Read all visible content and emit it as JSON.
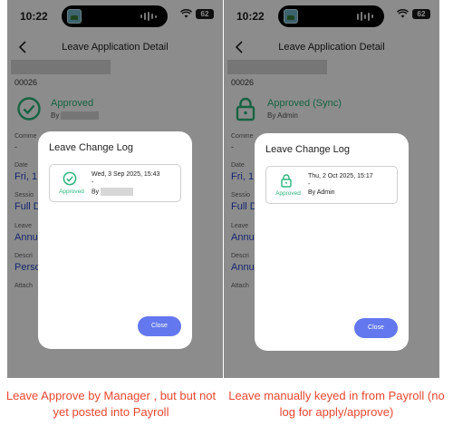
{
  "colors": {
    "approved": "#2bb57c",
    "link_value": "#2746c9",
    "close_button": "#6378ee",
    "caption": "#e8472f"
  },
  "left": {
    "status_bar": {
      "time": "10:22",
      "battery": "62"
    },
    "header": {
      "title": "Leave Application Detail"
    },
    "detail": {
      "ref_number": "00026",
      "status_icon": "check-circle-icon",
      "status": "Approved",
      "status_by": "By",
      "comment_label": "Comme",
      "comment_value": "-",
      "date_label": "Date",
      "date_value": "Fri, 1",
      "session_label": "Sessio",
      "session_value": "Full D",
      "leave_type_label": "Leave",
      "leave_type_value": "Annu",
      "description_label": "Descri",
      "description_value": "Perso",
      "attachment_label": "Attach"
    },
    "modal": {
      "title": "Leave Change Log",
      "entry": {
        "icon": "check-circle-icon",
        "status": "Approved",
        "date": "Wed, 3 Sep 2025, 15:43",
        "dash": "-",
        "by": "By"
      },
      "close_label": "Close"
    },
    "caption": "Leave Approve by Manager , but but not yet posted into Payroll"
  },
  "right": {
    "status_bar": {
      "time": "10:22",
      "battery": "62"
    },
    "header": {
      "title": "Leave Application Detail"
    },
    "detail": {
      "ref_number": "00026",
      "status_icon": "lock-icon",
      "status": "Approved (Sync)",
      "status_by": "By Admin",
      "comment_label": "Comme",
      "comment_value": "-",
      "date_label": "Date",
      "date_value": "Fri, 1",
      "session_label": "Sessio",
      "session_value": "Full D",
      "leave_type_label": "Leave",
      "leave_type_value": "Annu",
      "description_label": "Descri",
      "description_value": "Annu",
      "attachment_label": "Attach"
    },
    "modal": {
      "title": "Leave Change Log",
      "entry": {
        "icon": "lock-icon",
        "status": "Approved",
        "date": "Thu, 2 Oct 2025, 15:17",
        "dash": "-",
        "by": "By Admin"
      },
      "close_label": "Close"
    },
    "caption": "Leave manually keyed in from Payroll (no log for apply/approve)"
  }
}
